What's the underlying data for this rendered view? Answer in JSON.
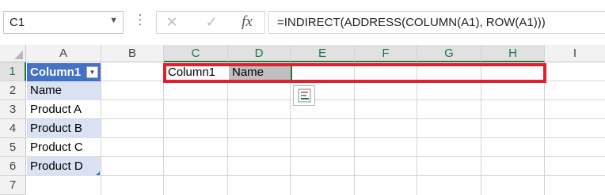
{
  "name_box": {
    "value": "C1"
  },
  "formula_bar": {
    "cancel_icon": "✕",
    "enter_icon": "✓",
    "fx_label": "fx",
    "formula": "=INDIRECT(ADDRESS(COLUMN(A1), ROW(A1)))"
  },
  "columns": [
    "A",
    "B",
    "C",
    "D",
    "E",
    "F",
    "G",
    "H",
    "I"
  ],
  "rows": [
    "1",
    "2",
    "3",
    "4",
    "5",
    "6",
    "7"
  ],
  "table": {
    "header": "Column1",
    "values": [
      "Name",
      "Product A",
      "Product B",
      "Product C",
      "Product D"
    ]
  },
  "cells": {
    "C1": "Column1",
    "D1": "Name"
  },
  "colors": {
    "accent": "#217346",
    "table_header": "#4472c4",
    "table_band": "#d9e1f2",
    "highlight": "#e0202c"
  },
  "icons": {
    "quick_analysis": "quick-analysis-icon",
    "filter": "filter-dropdown-icon"
  }
}
